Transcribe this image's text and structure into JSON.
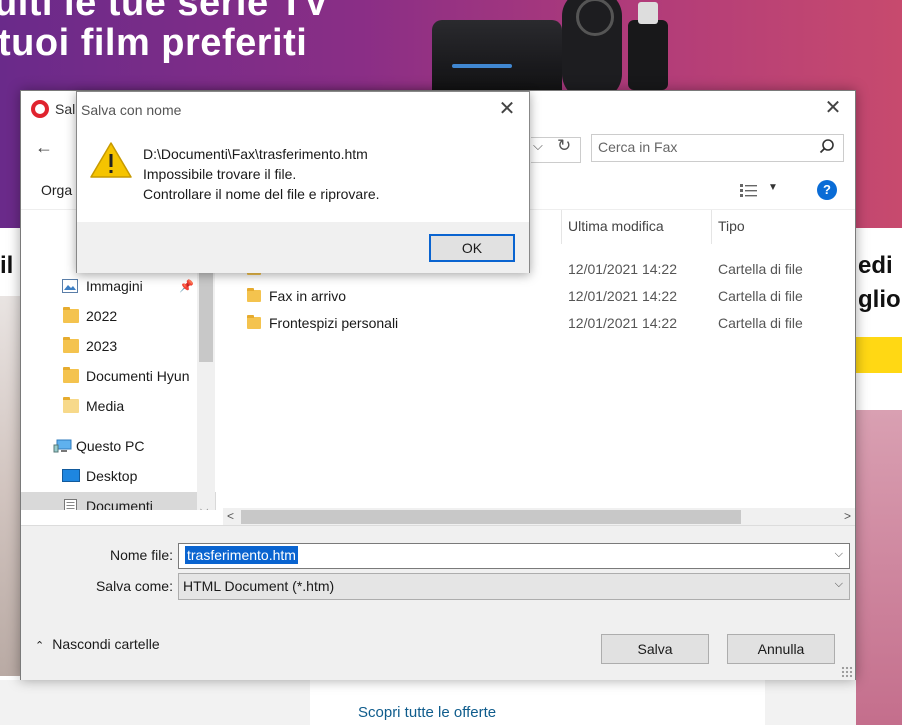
{
  "background": {
    "hero_line1": "uiti le tue serie TV",
    "hero_line2": "tuoi film preferiti",
    "left_text": "il",
    "right_text1": "edi",
    "right_text2": "gliori",
    "link": "Scopri tutte le offerte",
    "hero_colors": [
      "#6a2a8a",
      "#c74a6e"
    ]
  },
  "dialog": {
    "title_partial": "Sal",
    "search_placeholder": "Cerca in Fax",
    "toolbar_organize": "Orga",
    "nav_items": [
      {
        "label": "Immagini",
        "icon": "pictures-icon",
        "pinned": true
      },
      {
        "label": "2022",
        "icon": "folder-icon"
      },
      {
        "label": "2023",
        "icon": "folder-icon"
      },
      {
        "label": "Documenti Hyun",
        "icon": "folder-icon"
      },
      {
        "label": "Media",
        "icon": "folder-icon"
      },
      {
        "label": "Questo PC",
        "icon": "computer-icon"
      },
      {
        "label": "Desktop",
        "icon": "desktop-icon"
      },
      {
        "label": "Documenti",
        "icon": "documents-icon",
        "selected": true
      }
    ],
    "columns": {
      "modified": "Ultima modifica",
      "type": "Tipo"
    },
    "files": [
      {
        "name": "",
        "modified": "12/01/2021 14:22",
        "type": "Cartella di file"
      },
      {
        "name": "Fax in arrivo",
        "modified": "12/01/2021 14:22",
        "type": "Cartella di file"
      },
      {
        "name": "Frontespizi personali",
        "modified": "12/01/2021 14:22",
        "type": "Cartella di file"
      }
    ],
    "filename_label": "Nome file:",
    "filename_value": "trasferimento.htm",
    "savetype_label": "Salva come:",
    "savetype_value": "HTML Document (*.htm)",
    "hide_folders": "Nascondi cartelle",
    "save_button": "Salva",
    "cancel_button": "Annulla"
  },
  "error": {
    "title": "Salva con nome",
    "path": "D:\\Documenti\\Fax\\trasferimento.htm",
    "line2": "Impossibile trovare il file.",
    "line3": "Controllare il nome del file e riprovare.",
    "ok_button": "OK",
    "warning_color": "#f5c400",
    "accent_color": "#0a64d0"
  }
}
